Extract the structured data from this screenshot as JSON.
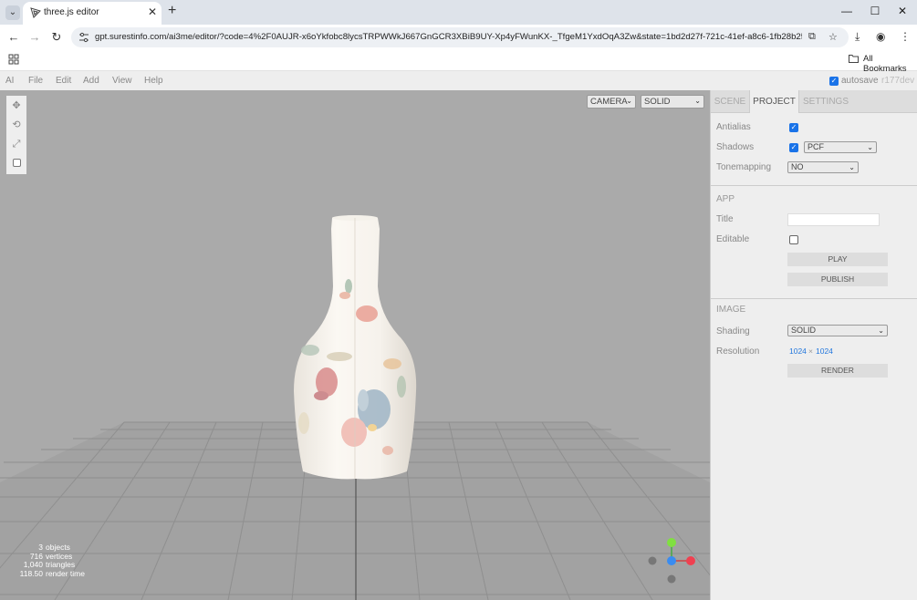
{
  "browser": {
    "tab_title": "three.js editor",
    "tab_close": "✕",
    "new_tab": "+",
    "url": "gpt.surestinfo.com/ai3me/editor/?code=4%2F0AUJR-x6oYkfobc8lycsTRPWWkJ667GnGCR3XBiB9UY-Xp4yFWunKX-_TfgeM1YxdOqA3Zw&state=1bd2d27f-721c-41ef-a8c6-1fb28b25e578&email...",
    "bookmarks_label": "All Bookmarks",
    "icons": [
      "tab-list-icon",
      "favicon-icon",
      "minimize-icon",
      "maximize-icon",
      "close-window-icon",
      "back-icon",
      "forward-icon",
      "reload-icon",
      "site-info-icon",
      "install-app-icon",
      "star-icon",
      "download-icon",
      "profile-icon",
      "menu-icon",
      "apps-icon",
      "folder-icon"
    ]
  },
  "menubar": {
    "items": [
      "AI",
      "File",
      "Edit",
      "Add",
      "View",
      "Help"
    ],
    "autosave_label": "autosave",
    "autosave_checked": true,
    "version": "r177dev"
  },
  "viewport": {
    "camera_select": "CAMERA",
    "shading_select": "SOLID",
    "tools": [
      "move-icon",
      "rotate-icon",
      "scale-icon",
      "local-toggle-icon"
    ],
    "info": [
      {
        "value": "3",
        "label": "objects"
      },
      {
        "value": "716",
        "label": "vertices"
      },
      {
        "value": "1,040",
        "label": "triangles"
      },
      {
        "value": "118.50",
        "label": "render time"
      }
    ]
  },
  "sidebar": {
    "tabs": [
      "SCENE",
      "PROJECT",
      "SETTINGS"
    ],
    "active_tab": "PROJECT",
    "renderer": {
      "antialias_label": "Antialias",
      "antialias": true,
      "shadows_label": "Shadows",
      "shadows": true,
      "shadow_type": "PCF",
      "tonemapping_label": "Tonemapping",
      "tonemapping": "NO"
    },
    "app": {
      "title": "APP",
      "title_label": "Title",
      "title_value": "",
      "editable_label": "Editable",
      "editable": false,
      "play_button": "PLAY",
      "publish_button": "PUBLISH"
    },
    "image": {
      "title": "IMAGE",
      "shading_label": "Shading",
      "shading": "SOLID",
      "resolution_label": "Resolution",
      "width": "1024",
      "times": "×",
      "height": "1024",
      "render_button": "RENDER"
    }
  },
  "colors": {
    "accent": "#1a73e8",
    "viewport_bg": "#aaaaaa",
    "panel_bg": "#eeeeee",
    "resolution_link": "#2277dd"
  }
}
